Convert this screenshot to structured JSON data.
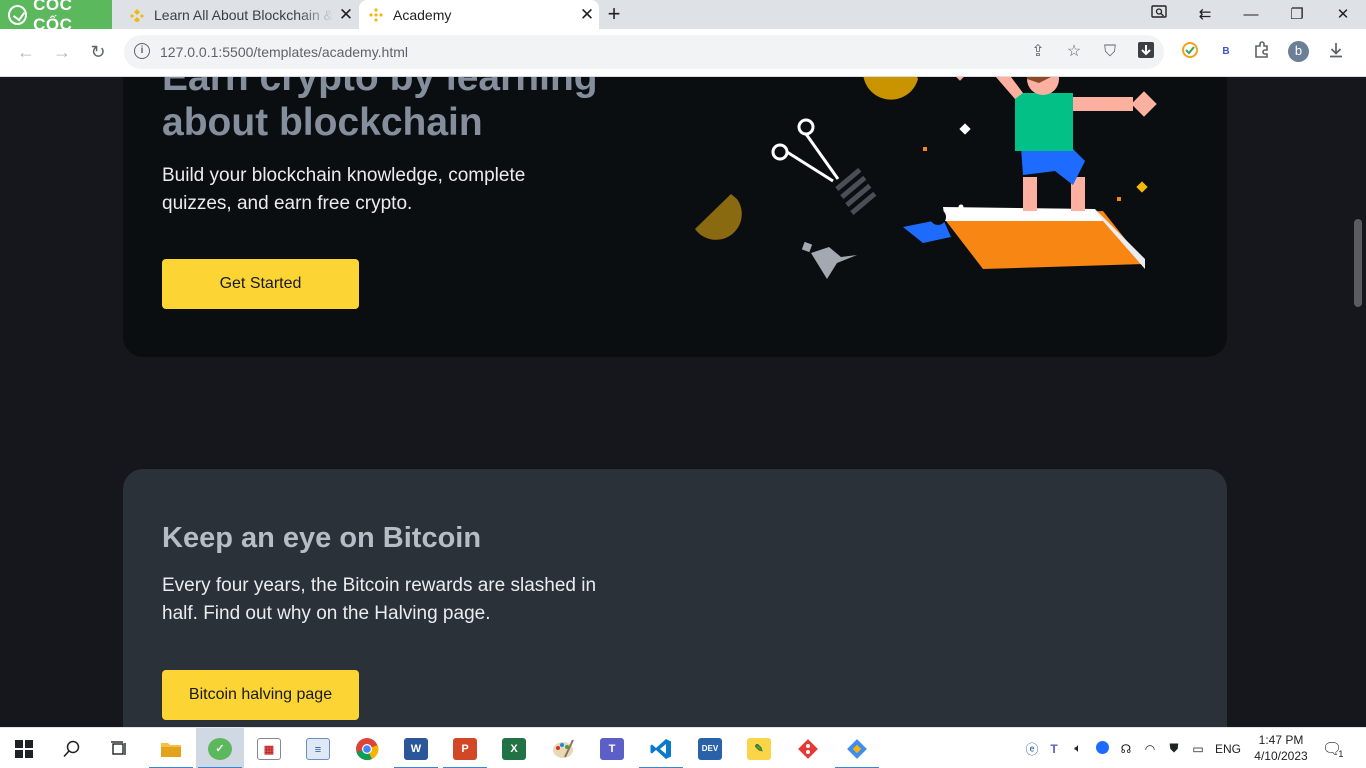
{
  "browser": {
    "brand": "CỐC CỐC",
    "tabs": [
      {
        "title": "Learn All About Blockchain & Crypto",
        "active": false
      },
      {
        "title": "Academy",
        "active": true
      }
    ],
    "url": "127.0.0.1:5500/templates/academy.html",
    "profile_initial": "b",
    "extension_letter": "B"
  },
  "page": {
    "hero": {
      "title_line1": "Earn crypto by learning",
      "title_line2": "about blockchain",
      "description": "Build your blockchain knowledge, complete quizzes, and earn free crypto.",
      "cta_label": "Get Started"
    },
    "bitcoin_card": {
      "title": "Keep an eye on Bitcoin",
      "description": "Every four years, the Bitcoin rewards are slashed in half. Find out why on the Halving page.",
      "cta_label": "Bitcoin halving page"
    }
  },
  "taskbar": {
    "apps": [
      "start",
      "search",
      "task-view",
      "file-explorer",
      "coccoc",
      "calendar",
      "notepad",
      "chrome",
      "word",
      "powerpoint",
      "excel",
      "paint",
      "teams",
      "vscode",
      "devc",
      "sticky",
      "git",
      "sourcetree"
    ],
    "language": "ENG",
    "time": "1:47 PM",
    "date": "4/10/2023",
    "notification_count": "1"
  },
  "colors": {
    "accent_yellow": "#fcd535",
    "hero_bg": "#0b0e11",
    "card_bg": "#2b3139",
    "page_bg": "#16171c"
  }
}
